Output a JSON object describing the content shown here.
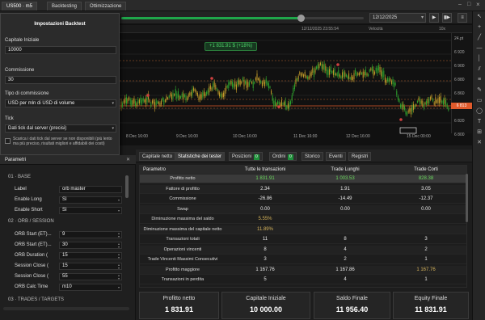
{
  "titlebar": {
    "tabs": [
      {
        "label": "US500 · m5"
      },
      {
        "label": "Backtesting"
      },
      {
        "label": "Ottimizzazione"
      }
    ]
  },
  "toolbar": {
    "end_date": "12/12/2025",
    "slider_progress": 0.74
  },
  "chart": {
    "header_datetime": "12/12/2025 23:55:54",
    "header_speed_label": "Velocità",
    "header_zoom": "10x",
    "profit_pill": "+1 831.91 $ (+18%)",
    "current_price_badge": "6 813",
    "y_ticks": [
      "24.pt",
      "6 920",
      "6 900",
      "6 880",
      "6 860",
      "6 840",
      "6 820",
      "6 800"
    ],
    "x_ticks": [
      "8 Dec 16:00",
      "9 Dec 16:00",
      "10 Dec 16:00",
      "11 Dec 16:00",
      "12 Dec 16:00",
      "15 Dec 00:00"
    ]
  },
  "settings": {
    "title": "Impostazioni Backtest",
    "capital_label": "Capitale Iniziale",
    "capital_value": "10000",
    "commission_label": "Commissione",
    "commission_value": "30",
    "commission_type_label": "Tipo di commissione",
    "commission_type_value": "USD per mln di USD di volume",
    "tick_label": "Tick",
    "tick_value": "Dati tick dal server (precisi)",
    "note": "Scarica i dati tick dal server se non disponibili (più lento ma più preciso, risultati migliori e affidabili dei costi)"
  },
  "params": {
    "header": "Parametri",
    "section1": "01 · BASE",
    "label_field": "Label",
    "label_value": "orb master",
    "enable_long": "Enable Long",
    "enable_long_value": "Sì",
    "enable_short": "Enable Short",
    "enable_short_value": "Sì",
    "section2": "02 · ORB / SESSION",
    "orb_start_h": "ORB Start (ET)...",
    "orb_start_h_value": "9",
    "orb_start_m": "ORB Start (ET)...",
    "orb_start_m_value": "30",
    "orb_duration": "ORB Duration (",
    "orb_duration_value": "15",
    "session_close_h": "Session Close (",
    "session_close_h_value": "15",
    "session_close_m": "Session Close (",
    "session_close_m_value": "55",
    "orb_calc_time": "ORB Calc Time",
    "orb_calc_time_value": "m10",
    "section3": "03 · TRADES / TARGETS"
  },
  "results": {
    "tabs": [
      {
        "label": "Capitale netto"
      },
      {
        "label": "Statistiche dei tester"
      },
      {
        "label": "Posizioni",
        "badge": "0"
      },
      {
        "label": "Ordini",
        "badge": "0"
      },
      {
        "label": "Storico"
      },
      {
        "label": "Eventi"
      },
      {
        "label": "Registri"
      }
    ],
    "columns": [
      "Parametro",
      "Tutte le transazioni",
      "Trade Lunghi",
      "Trade Corti"
    ],
    "rows": [
      {
        "p": "Profitto netto",
        "a": "1 831.91",
        "b": "1 003.53",
        "c": "828.38",
        "hl": true
      },
      {
        "p": "Fattore di profitto",
        "a": "2.34",
        "b": "1.91",
        "c": "3.05"
      },
      {
        "p": "Commissione",
        "a": "-26.86",
        "b": "-14.49",
        "c": "-12.37"
      },
      {
        "p": "Swap",
        "a": "0.00",
        "b": "0.00",
        "c": "0.00"
      },
      {
        "p": "Diminuzione massima del saldo",
        "a": "5.55%",
        "b": "",
        "c": ""
      },
      {
        "p": "Diminuzione massima del capitale netto",
        "a": "11.89%",
        "b": "",
        "c": ""
      },
      {
        "p": "Transazioni totali",
        "a": "11",
        "b": "8",
        "c": "3"
      },
      {
        "p": "Operazioni vincenti",
        "a": "8",
        "b": "4",
        "c": "2"
      },
      {
        "p": "Trade Vincenti Massimi Consecutivi",
        "a": "3",
        "b": "2",
        "c": "1"
      },
      {
        "p": "Profitto maggiore",
        "a": "1 167.76",
        "b": "1 167.86",
        "c": "1 167.76"
      },
      {
        "p": "Transazioni in perdita",
        "a": "5",
        "b": "4",
        "c": "1"
      }
    ]
  },
  "cards": [
    {
      "title": "Profitto netto",
      "value": "1 831.91"
    },
    {
      "title": "Capitale Iniziale",
      "value": "10 000.00"
    },
    {
      "title": "Saldo Finale",
      "value": "11 956.40"
    },
    {
      "title": "Equity Finale",
      "value": "11 831.91"
    }
  ],
  "colors": {
    "accent_green": "#1fa64a",
    "price_badge": "#e05a2b",
    "up_candle": "#2faa2f",
    "down_candle": "#c8a02b"
  }
}
